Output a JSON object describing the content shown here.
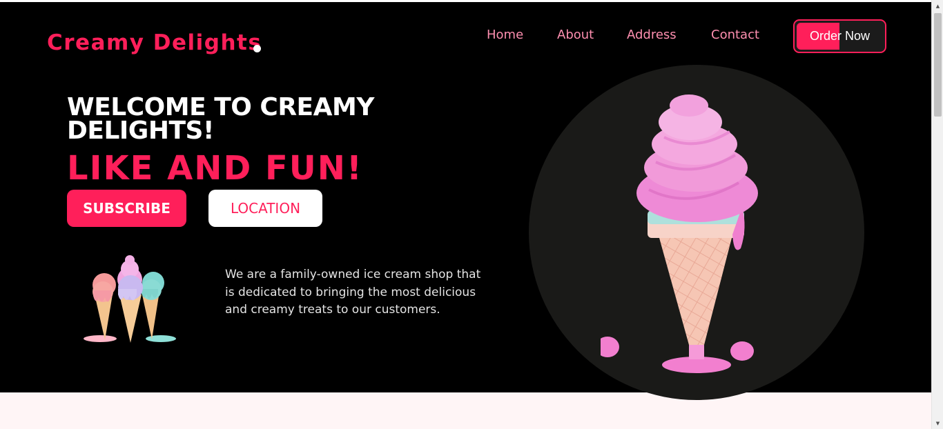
{
  "brand": {
    "logo_text": "Creamy Delights",
    "accent_color": "#ff1f5a",
    "nav_link_color": "#ff8fb0",
    "background_color": "#000000"
  },
  "nav": {
    "items": [
      {
        "label": "Home"
      },
      {
        "label": "About"
      },
      {
        "label": "Address"
      },
      {
        "label": "Contact"
      }
    ],
    "order_button": "Order Now"
  },
  "hero": {
    "welcome": "WELCOME TO CREAMY DELIGHTS!",
    "tagline": "LIKE AND FUN!",
    "subscribe_button": "SUBSCRIBE",
    "location_button": "LOCATION",
    "description": "We are a family-owned ice cream shop that is dedicated to bringing the most delicious and creamy treats to our customers."
  },
  "icons": {
    "scroll_up": "triangle-up-icon",
    "scroll_down": "triangle-down-icon"
  }
}
